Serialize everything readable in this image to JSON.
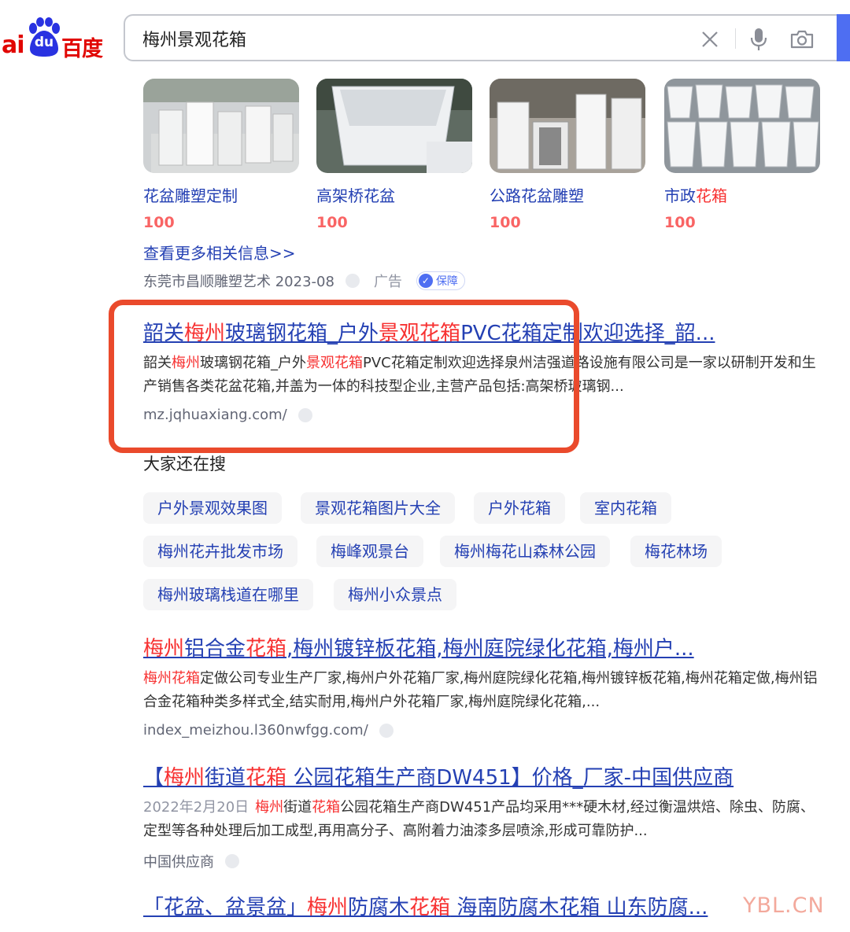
{
  "header": {
    "logo": {
      "ai": "ai",
      "du": "du",
      "cn": "百度"
    },
    "search": {
      "value": "梅州景观花箱"
    },
    "icons": [
      "close-icon",
      "microphone-icon",
      "camera-icon"
    ]
  },
  "cards": [
    {
      "title": "花盆雕塑定制",
      "price": "100"
    },
    {
      "title": "高架桥花盆",
      "price": "100"
    },
    {
      "title": "公路花盆雕塑",
      "price": "100"
    },
    {
      "title_plain": "市政",
      "title_red": "花箱",
      "price": "100"
    }
  ],
  "ad": {
    "more_link": "查看更多相关信息>>",
    "source": "东莞市昌顺雕塑艺术 2023-08",
    "label": "广告",
    "badge": "保障"
  },
  "results": [
    {
      "title_parts": [
        "韶关",
        "梅州",
        "玻璃钢花箱_户外",
        "景观花箱",
        "PVC花箱定制欢迎选择_韶..."
      ],
      "abstract_parts": [
        "韶关",
        "梅州",
        "玻璃钢花箱_户外",
        "景观花箱",
        "PVC花箱定制欢迎选择泉州洁强道路设施有限公司是一家以研制开发和生产销售各类花盆花箱,并盖为一体的科技型企业,主营产品包括:高架桥玻璃钢..."
      ],
      "url": "mz.jqhuaxiang.com/"
    },
    {
      "title_parts": [
        "梅州",
        "铝合金",
        "花箱",
        ",梅州镀锌板花箱,梅州庭院绿化花箱,梅州户..."
      ],
      "abstract_parts": [
        "梅州花箱",
        "定做公司专业生产厂家,梅州户外花箱厂家,梅州庭院绿化花箱,梅州镀锌板花箱,梅州花箱定做,梅州铝合金花箱种类多样式全,结实耐用,梅州户外花箱厂家,梅州庭院绿化花箱,..."
      ],
      "url": "index_meizhou.l360nwfgg.com/"
    },
    {
      "title_parts": [
        "【",
        "梅州",
        "街道",
        "花箱",
        " 公园花箱生产商DW451】价格_厂家-中国供应商"
      ],
      "date": "2022年2月20日",
      "abstract_parts": [
        "梅州",
        "街道",
        "花箱",
        "公园花箱生产商DW451产品均采用***硬木材,经过衡温烘焙、除虫、防腐、定型等各种处理后加工成型,再用高分子、高附着力油漆多层喷涂,形成可靠防护..."
      ],
      "url": "中国供应商"
    },
    {
      "title_parts": [
        "「花盆、盆景盆」",
        "梅州",
        "防腐木",
        "花箱",
        " 海南防腐木花箱 山东防腐..."
      ]
    }
  ],
  "related": {
    "title": "大家还在搜",
    "tags": [
      "户外景观效果图",
      "景观花箱图片大全",
      "户外花箱",
      "室内花箱",
      "梅州花卉批发市场",
      "梅峰观景台",
      "梅州梅花山森林公园",
      "梅花林场",
      "梅州玻璃栈道在哪里",
      "梅州小众景点"
    ]
  },
  "watermark": "YBL.CN",
  "colors": {
    "link": "#2440b3",
    "highlight": "#f73131",
    "brand_blue": "#4e6ef2",
    "annotation_box": "#ea4a2c"
  }
}
